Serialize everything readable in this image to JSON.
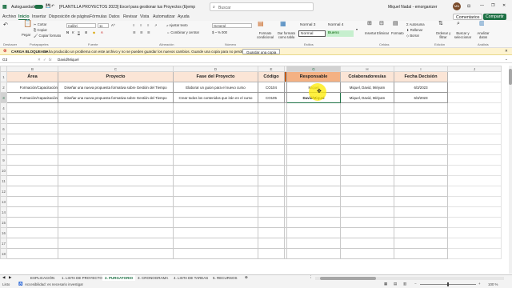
{
  "titlebar": {
    "autosave_label": "Autoguardado",
    "doc_title": "[PLANTILLA PROYECTOS 2023] Excel para gestionar tus Proyectos (Ejemplo) • Carga bloqueada",
    "search_placeholder": "Buscar",
    "user_name": "Miquel Nadal - emorganizer",
    "user_initials": "MN"
  },
  "ribbon_tabs": [
    "Archivo",
    "Inicio",
    "Insertar",
    "Disposición de página",
    "Fórmulas",
    "Datos",
    "Revisar",
    "Vista",
    "Automatizar",
    "Ayuda"
  ],
  "ribbon_active_tab": "Inicio",
  "ribbon_buttons": {
    "comments": "Comentarios",
    "share": "Compartir"
  },
  "ribbon": {
    "paste": "Pegar",
    "cut": "Cortar",
    "copy": "Copiar",
    "format_painter": "Copiar formato",
    "font_name": "Calibri",
    "font_size": "11",
    "wrap_text": "Ajustar texto",
    "merge_center": "Combinar y centrar",
    "number_format": "General",
    "cond_format": "Formato condicional",
    "format_table": "Dar formato como tabla",
    "style_normal3": "Normal 3",
    "style_normal4": "Normal 4",
    "style_normal": "Normal",
    "style_good": "Bueno",
    "insert": "Insertar",
    "delete": "Eliminar",
    "format": "Formato",
    "autosum": "Autosuma",
    "fill": "Rellenar",
    "clear": "Borrar",
    "sort_filter": "Ordenar y filtrar",
    "find_select": "Buscar y seleccionar",
    "analyze": "Analizar datos",
    "groups": [
      "Deshacer",
      "Portapapeles",
      "Fuente",
      "Alineación",
      "Número",
      "Estilos",
      "Celdas",
      "Edición",
      "Análisis"
    ]
  },
  "warning": {
    "title": "CARGA BLOQUEADA",
    "message": "Se ha producido un problema con este archivo y no se pueden guardar los nuevos cambios. Guarde una copia para no perder su trabajo.",
    "button": "Guardar una copia"
  },
  "formula_bar": {
    "name_box": "G3",
    "content": "David/Miquel"
  },
  "columns": [
    "B",
    "C",
    "D",
    "E",
    "F",
    "G",
    "H",
    "I",
    "J"
  ],
  "col_letters": [
    "B",
    "C",
    "D",
    "E",
    "G",
    "H",
    "I",
    "J",
    "K"
  ],
  "table": {
    "headers": [
      "Área",
      "Proyecto",
      "Fase del Proyecto",
      "Código",
      "Responsable",
      "Colaboradores/as",
      "Fecha Decisión"
    ],
    "rows": [
      [
        "Formación/Capacitación",
        "Diseñar una nueva propuesta formativa sobre Gestión del Tiempo",
        "Elaborar un guion para el nuevo curso",
        "CO104",
        "Miquel",
        "Miquel, David, Miriyam",
        "6/3/2023"
      ],
      [
        "Formación/Capacitación",
        "Diseñar una nueva propuesta formativa sobre Gestión del Tiempo",
        "Crear todos los contenidos que irán en el curso",
        "CO105",
        "David/Miquel",
        "Miquel, David, Miriyam",
        "6/3/2023"
      ]
    ]
  },
  "row_numbers": [
    "1",
    "2",
    "3",
    "4",
    "5",
    "6",
    "7",
    "8",
    "9",
    "10",
    "11",
    "12",
    "13",
    "14",
    "15",
    "16",
    "17",
    "18"
  ],
  "sheet_tabs": [
    "EXPLICACIÓN",
    "1. LISTA DE PROYECTOS",
    "2. PURGATORIO",
    "3. CRONOGRAMA",
    "4. LISTA DE TAREAS",
    "5. RECURSOS"
  ],
  "sheet_active": "2. PURGATORIO",
  "status": {
    "ready": "Listo",
    "accessibility": "Accesibilidad: es necesario investigar",
    "zoom": "100 %"
  }
}
